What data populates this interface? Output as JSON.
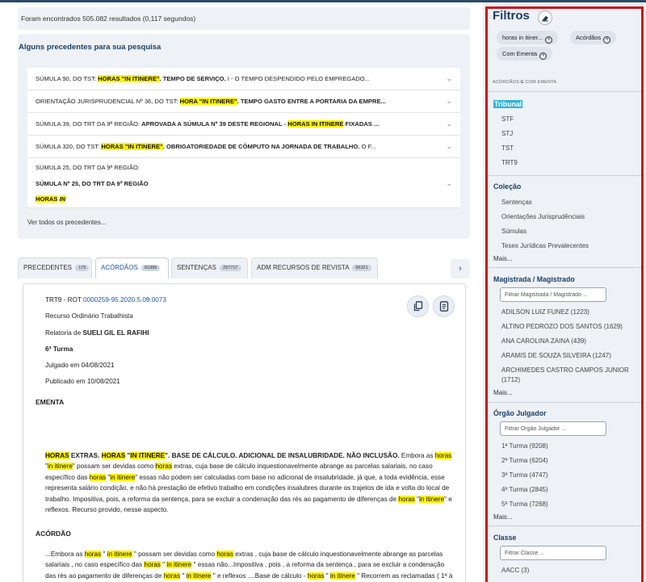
{
  "results_count": "Foram encontrados 505.082 resultados (0,117 segundos)",
  "precedents": {
    "title": "Alguns precedentes para sua pesquisa",
    "items": [
      {
        "prefix": "SÚMULA 90, DO TST: ",
        "hl1": "HORAS \"IN ITINERE\"",
        "bold": ". TEMPO DE SERVIÇO.",
        "rest": " I - O TEMPO DESPENDIDO PELO EMPREGADO..."
      },
      {
        "prefix": "ORIENTAÇÃO JURISPRUDENCIAL Nº 36, DO TST: ",
        "hl1": "HORA \"IN ITINERE\"",
        "bold": ". TEMPO GASTO ENTRE A PORTARIA DA EMPRE...",
        "rest": ""
      },
      {
        "prefix": "SÚMULA 39, DO TRT DA 9ª REGIÃO: ",
        "bold1": "APROVADA A SÚMULA Nº 39 DESTE REGIONAL - ",
        "hl1": "HORAS IN ITINERE",
        "bold": " FIXADAS ...",
        "rest": ""
      },
      {
        "prefix": "SÚMULA 320, DO TST: ",
        "hl1": "HORAS \"IN ITINERE\"",
        "bold": ". OBRIGATORIEDADE DE CÔMPUTO NA JORNADA DE TRABALHO.",
        "rest": " O F..."
      },
      {
        "line1": "SÚMULA 25, DO TRT DA 9ª REGIÃO:",
        "line2": "SÚMULA Nº 25, DO TRT DA 9ª REGIÃO",
        "line3a": "HORAS",
        "line3b": "IN"
      }
    ],
    "see_all": "Ver todos os precedentes..."
  },
  "tabs": [
    {
      "label": "PRECEDENTES",
      "count": "175"
    },
    {
      "label": "ACÓRDÃOS",
      "count": "81889"
    },
    {
      "label": "SENTENÇAS",
      "count": "257717"
    },
    {
      "label": "ADM RECURSOS DE REVISTA",
      "count": "65321"
    }
  ],
  "result": {
    "court_prefix": "TRT9 - ROT ",
    "case_number": "0000259-95.2020.5.09.0073",
    "type": "Recurso Ordinário Trabalhista",
    "rapporteur_prefix": "Relatoria de ",
    "rapporteur": "SUELI GIL EL RAFIHI",
    "panel": "6ª Turma",
    "judged": "Julgado em 04/08/2021",
    "published": "Publicado em 10/08/2021",
    "ementa_label": "EMENTA",
    "acordao_label": "ACÓRDÃO"
  },
  "filters": {
    "title": "Filtros",
    "chips": [
      "horas in itiner...",
      "Acórdãos",
      "Com Ementa"
    ],
    "caption_a": "ACÓRDÃOS",
    "caption_e": "E",
    "caption_b": "COM EMENTA",
    "tribunal": {
      "heading": "Tribunal",
      "items": [
        "STF",
        "STJ",
        "TST",
        "TRT9"
      ]
    },
    "colecao": {
      "heading": "Coleção",
      "items": [
        "Sentenças",
        "Orientações Jurisprudênciais",
        "Súmulas",
        "Teses Jurídicas Prevalecentes"
      ],
      "more": "Mais..."
    },
    "magistrada": {
      "heading": "Magistrada / Magistrado",
      "placeholder": "Filtrar Magistrada / Magistrado ...",
      "items": [
        "ADILSON LUIZ FUNEZ   (1223)",
        "ALTINO PEDROZO DOS SANTOS   (1629)",
        "ANA CAROLINA ZAINA   (439)",
        "ARAMIS DE SOUZA SILVEIRA   (1247)",
        "ARCHIMEDES CASTRO CAMPOS JUNIOR",
        "(1712)"
      ],
      "more": "Mais..."
    },
    "orgao": {
      "heading": "Órgão Julgador",
      "placeholder": "Filtrar Orgão Julgador ...",
      "items": [
        "1ª Turma   (9208)",
        "2ª Turma   (6204)",
        "3ª Turma   (4747)",
        "4ª Turma   (2845)",
        "5ª Turma   (7268)"
      ],
      "more": "Mais..."
    },
    "classe": {
      "heading": "Classe",
      "placeholder": "Filtrar Classe ...",
      "items": [
        "AACC   (3)"
      ]
    }
  }
}
